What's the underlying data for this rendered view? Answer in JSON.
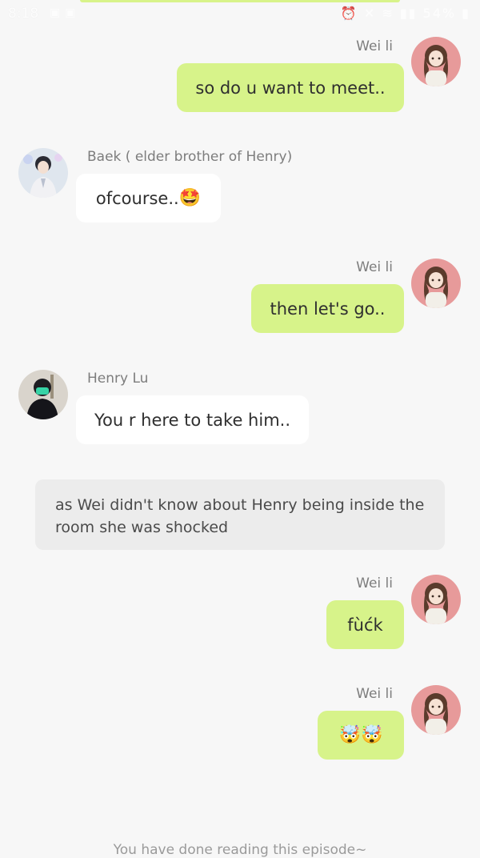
{
  "status_bar": {
    "time": "8:18",
    "left_icons": [
      "gallery-icon",
      "notification-icon"
    ],
    "right_text": "54%",
    "right_icons": [
      "alarm-icon",
      "mute-icon",
      "wifi-icon",
      "signal-icon",
      "battery-icon"
    ]
  },
  "messages": [
    {
      "sender": "Wei li",
      "side": "right",
      "text": "so do u want to meet.."
    },
    {
      "sender": "Baek ( elder brother of Henry)",
      "side": "left",
      "text": "ofcourse..",
      "emoji": "🤩"
    },
    {
      "sender": "Wei li",
      "side": "right",
      "text": "then let's go.."
    },
    {
      "sender": "Henry Lu",
      "side": "left",
      "text": "You r here to take him.."
    },
    {
      "sender": "Wei li",
      "side": "right",
      "text": "fùćk"
    },
    {
      "sender": "Wei li",
      "side": "right",
      "text": "",
      "emoji": "🤯🤯"
    }
  ],
  "narration": "as Wei didn't know about Henry being inside the room she was shocked",
  "footer": "You have done reading this episode~",
  "colors": {
    "me_bubble": "#d7f38a",
    "other_bubble": "#ffffff",
    "narration_bg": "#ececec",
    "page_bg": "#f7f7f7"
  }
}
